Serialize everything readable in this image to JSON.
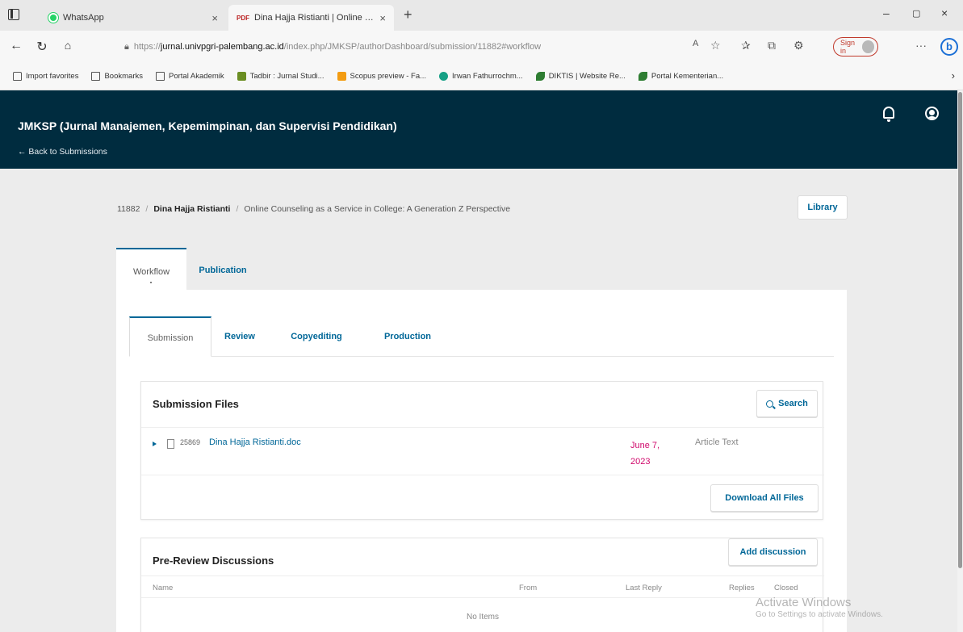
{
  "browser": {
    "tabs": [
      {
        "label": "WhatsApp",
        "close": "×"
      },
      {
        "label": "Dina Hajja Ristianti | Online Cou...",
        "mark": "PDF",
        "close": "×"
      }
    ],
    "new_tab": "+",
    "window_controls": {
      "minimize": "–",
      "restore": "⬜",
      "close": "×"
    },
    "url": {
      "scheme": "https://",
      "host": "jurnal.univpgri-palembang.ac.id",
      "path": "/index.php/JMKSP/authorDashboard/submission/11882#workflow"
    },
    "signin_label": "Sign in",
    "favorites": [
      {
        "label": "Import favorites",
        "icon": "folder"
      },
      {
        "label": "Bookmarks",
        "icon": "page"
      },
      {
        "label": "Portal Akademik",
        "icon": "page"
      },
      {
        "label": "Tadbir : Jurnal Studi...",
        "icon": "green"
      },
      {
        "label": "Scopus preview - Fa...",
        "icon": "orange"
      },
      {
        "label": "Irwan Fathurrochm...",
        "icon": "cyan"
      },
      {
        "label": "DIKTIS | Website Re...",
        "icon": "leaf"
      },
      {
        "label": "Portal Kementerian...",
        "icon": "leaf"
      }
    ]
  },
  "header": {
    "title": "JMKSP (Jurnal Manajemen, Kepemimpinan, dan Supervisi Pendidikan)",
    "back_link": "← Back to Submissions"
  },
  "breadcrumb": {
    "id": "11882",
    "author": "Dina Hajja Ristianti",
    "title": "Online Counseling as a Service in College: A Generation Z Perspective",
    "separator": "/"
  },
  "library_label": "Library",
  "main_tabs": {
    "workflow": "Workflow",
    "publication": "Publication"
  },
  "sub_tabs": {
    "submission": "Submission",
    "review": "Review",
    "copyediting": "Copyediting",
    "production": "Production"
  },
  "submission_files": {
    "title": "Submission Files",
    "search_label": "Search",
    "file": {
      "id": "25869",
      "name": "Dina Hajja Ristianti.doc",
      "date": "June 7, 2023",
      "type": "Article Text"
    },
    "download_all_label": "Download All Files"
  },
  "discussions": {
    "title": "Pre-Review Discussions",
    "add_label": "Add discussion",
    "columns": {
      "name": "Name",
      "from": "From",
      "last_reply": "Last Reply",
      "replies": "Replies",
      "closed": "Closed"
    },
    "empty": "No Items"
  },
  "watermark": {
    "line1": "Activate Windows",
    "line2": "Go to Settings to activate Windows."
  }
}
